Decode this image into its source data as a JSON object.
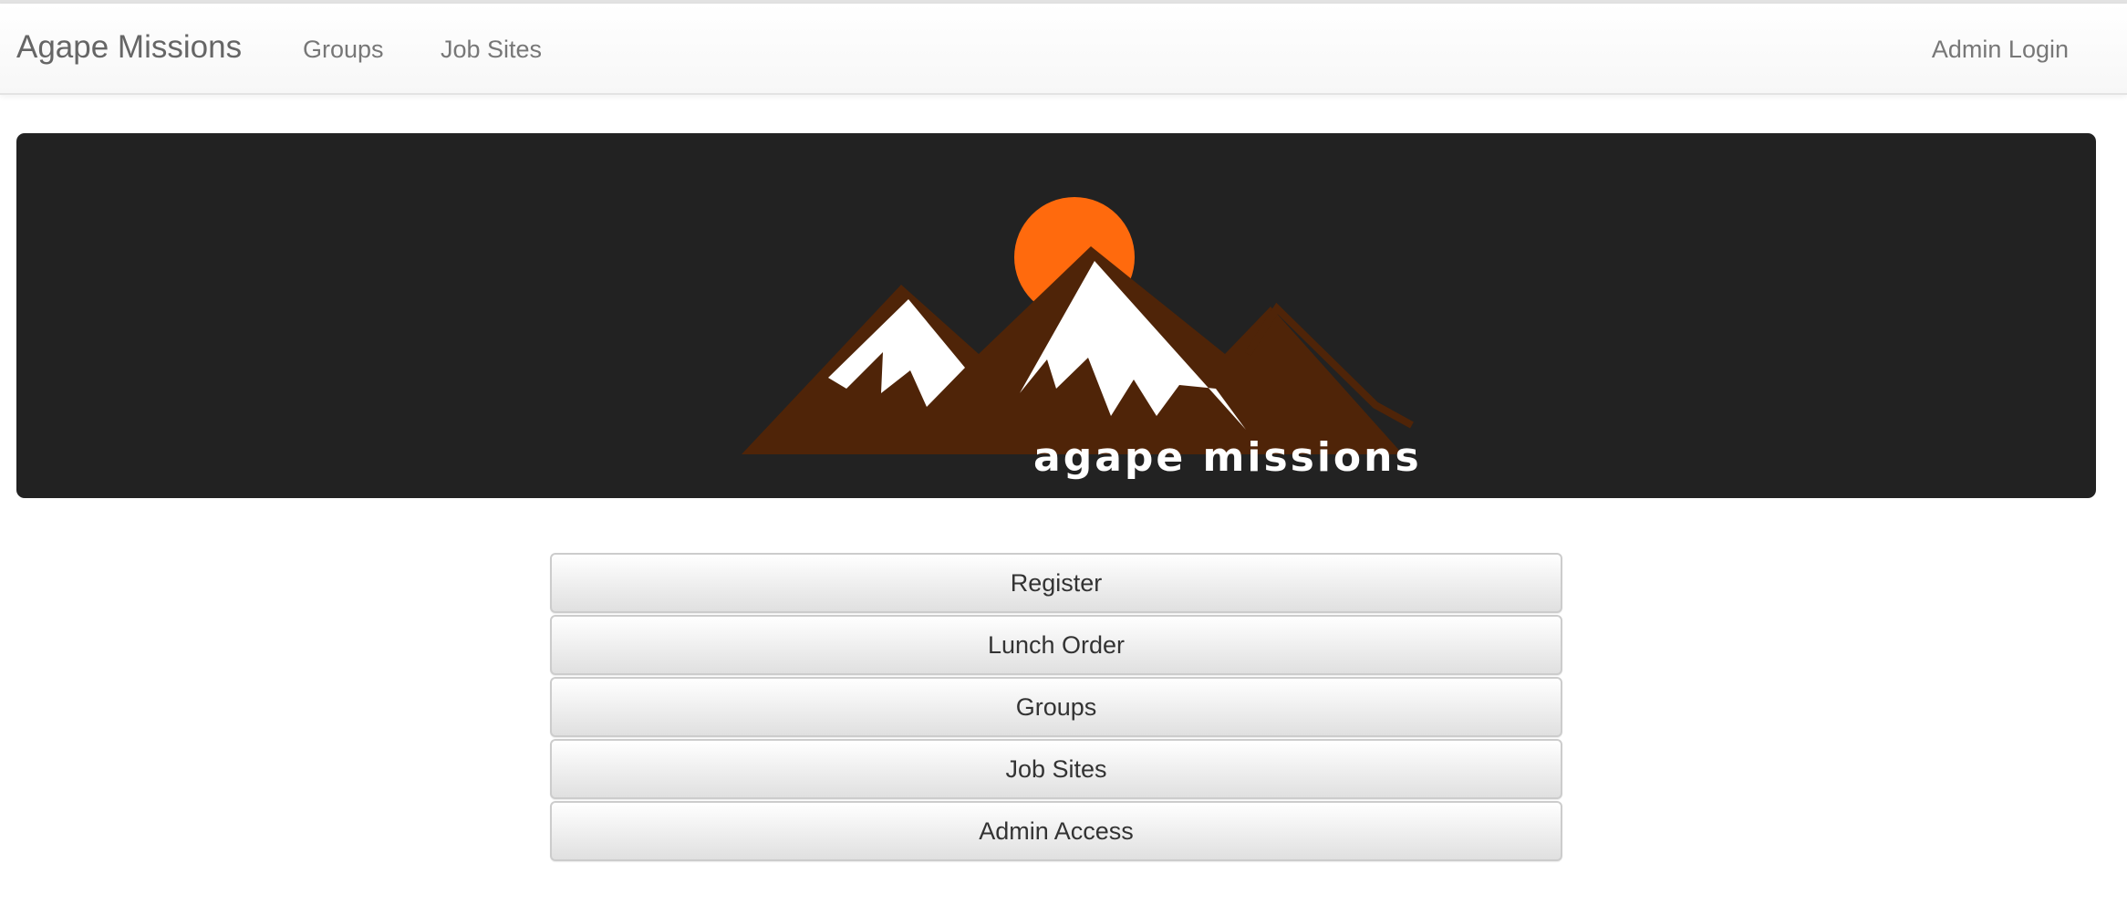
{
  "navbar": {
    "brand": "Agape Missions",
    "links": [
      "Groups",
      "Job Sites"
    ],
    "admin_login": "Admin Login"
  },
  "hero": {
    "logo_text": "agape missions",
    "colors": {
      "background": "#222222",
      "sun": "#ff6a0d",
      "mountain": "#4f2408",
      "snow": "#ffffff"
    }
  },
  "actions": [
    "Register",
    "Lunch Order",
    "Groups",
    "Job Sites",
    "Admin Access"
  ]
}
